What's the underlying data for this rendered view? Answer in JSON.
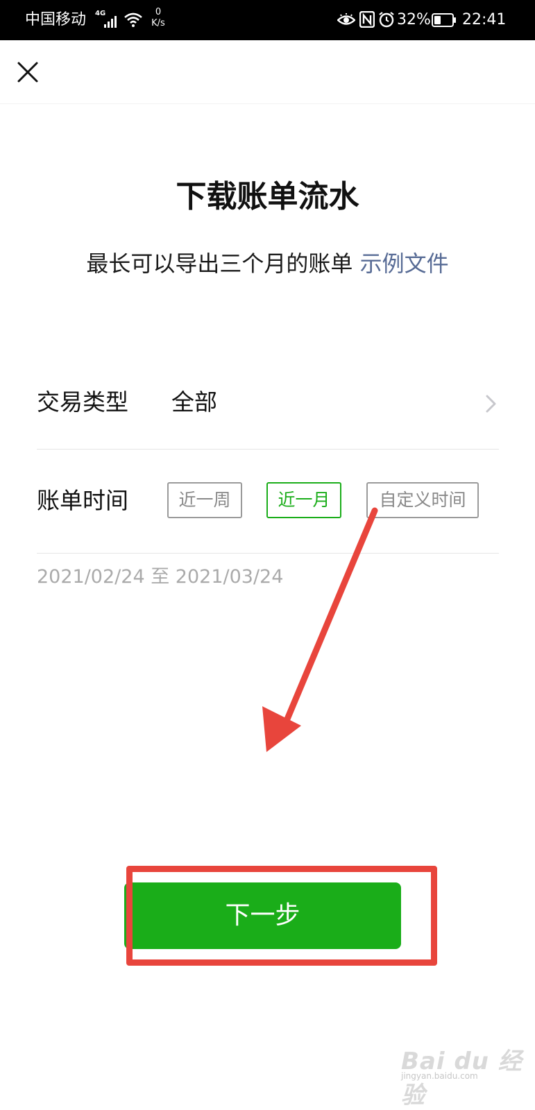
{
  "status_bar": {
    "carrier": "中国移动",
    "network": "4G",
    "net_speed_value": "0",
    "net_speed_unit": "K/s",
    "battery": "32%",
    "time": "22:41"
  },
  "header": {
    "close_icon": "close-icon"
  },
  "page": {
    "title": "下载账单流水",
    "subtitle": "最长可以导出三个月的账单",
    "example_link": "示例文件"
  },
  "form": {
    "transaction_type": {
      "label": "交易类型",
      "value": "全部"
    },
    "bill_time": {
      "label": "账单时间",
      "options": [
        "近一周",
        "近一月",
        "自定义时间"
      ],
      "selected": "近一月"
    },
    "date_range": "2021/02/24 至 2021/03/24"
  },
  "actions": {
    "next_label": "下一步"
  },
  "watermark": {
    "main": "Bai du 经验",
    "sub": "jingyan.baidu.com"
  },
  "colors": {
    "primary_green": "#1aad19",
    "link_blue": "#576b95",
    "annotation_red": "#e8453c"
  }
}
